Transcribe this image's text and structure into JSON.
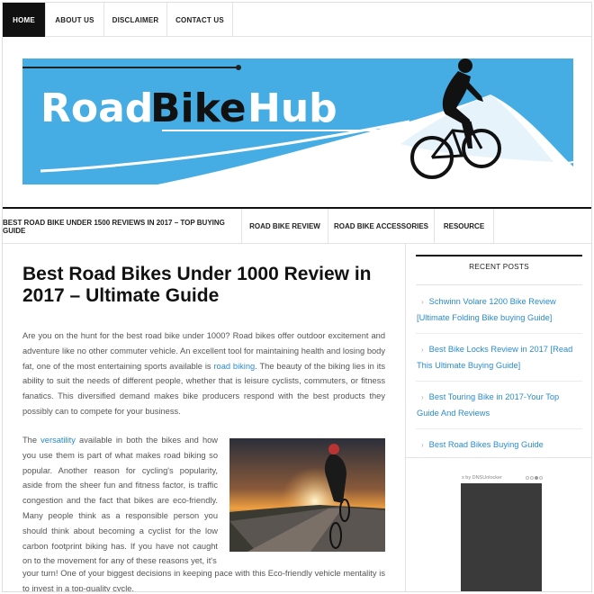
{
  "top_nav": {
    "items": [
      {
        "label": "HOME",
        "active": true
      },
      {
        "label": "ABOUT US",
        "active": false
      },
      {
        "label": "DISCLAIMER",
        "active": false
      },
      {
        "label": "CONTACT US",
        "active": false
      }
    ]
  },
  "header": {
    "logo_text_1": "Road",
    "logo_text_2": "Bike",
    "logo_text_3": "Hub",
    "banner_color": "#46ade4"
  },
  "sub_nav": {
    "items": [
      {
        "label": "BEST ROAD BIKE UNDER 1500 REVIEWS IN 2017 – TOP BUYING GUIDE"
      },
      {
        "label": "ROAD BIKE REVIEW"
      },
      {
        "label": "ROAD BIKE ACCESSORIES"
      },
      {
        "label": "RESOURCE"
      }
    ]
  },
  "post": {
    "title": "Best Road Bikes Under 1000 Review in 2017 – Ultimate Guide",
    "p1_before": "Are you on the hunt for the best road bike under 1000? Road bikes offer outdoor excitement and adventure like no other commuter vehicle. An excellent tool for maintaining health and losing body fat, one of the most entertaining sports available is ",
    "p1_link": "road biking",
    "p1_after": ". The beauty of the biking lies in its ability to suit the needs of different people, whether that is leisure cyclists, commuters, or fitness fanatics. This diversified demand makes bike producers respond with the best products they possibly can to compete for your business.",
    "p2_before": "The ",
    "p2_link": "versatility",
    "p2_after": " available in both the bikes and how you use them is part of what makes road biking so popular. Another reason for cycling's popularity, aside from the sheer fun and fitness factor, is traffic congestion and the fact that bikes are eco-friendly. Many people think as a responsible person you should think about becoming a cyclist for the low carbon footprint biking has. If you have not caught on to the movement for any of these reasons yet, it's",
    "p3": "your turn!  One of your biggest decisions in keeping pace with this Eco-friendly vehicle mentality is to invest in a top-quality cycle."
  },
  "sidebar": {
    "heading": "RECENT POSTS",
    "posts": [
      "Schwinn Volare 1200 Bike Review [Ultimate Folding Bike buying Guide]",
      "Best Bike Locks Review in 2017 [Read This Ultimate Buying Guide]",
      "Best Touring Bike in 2017-Your Top Guide And Reviews",
      "Best Road Bikes Buying Guide"
    ],
    "ad_label": "x by DNSUnlocker"
  },
  "colors": {
    "link": "#2a8bcd",
    "nav_active_bg": "#111111"
  }
}
